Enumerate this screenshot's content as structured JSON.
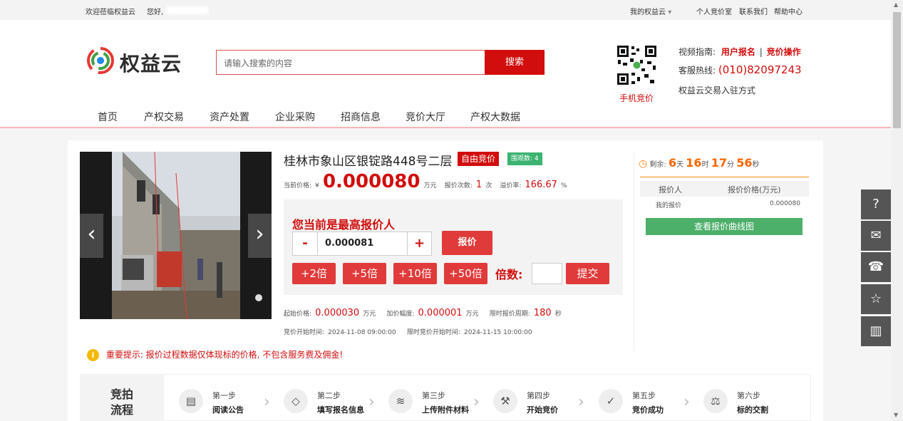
{
  "topbar": {
    "welcome": "欢迎莅临权益云",
    "hello": "您好,",
    "my_account": "我的权益云",
    "personal_bid": "个人竞价室",
    "contact": "联系我们",
    "help": "帮助中心"
  },
  "header": {
    "logo_text": "权益云",
    "search_placeholder": "请输入搜索的内容",
    "search_button": "搜索",
    "qr_label": "手机竞价",
    "video_guide_label": "视频指南:",
    "user_signup": "用户报名",
    "separator": "|",
    "bid_operation": "竞价操作",
    "hotline_label": "客服热线:",
    "hotline": "(010)82097243",
    "join": "权益云交易入驻方式"
  },
  "nav": [
    "首页",
    "产权交易",
    "资产处置",
    "企业采购",
    "招商信息",
    "竞价大厅",
    "产权大数据"
  ],
  "listing": {
    "title": "桂林市象山区银锭路448号二层",
    "tag_free": "自由竞价",
    "viewers_label": "围观数:",
    "viewers": "4",
    "current_price_label": "当前价格:",
    "currency": "¥",
    "current_price": "0.000080",
    "price_unit": "万元",
    "bid_count_label": "报价次数:",
    "bid_count": "1",
    "bid_count_unit": "次",
    "premium_label": "溢价率:",
    "premium": "166.67",
    "premium_unit": "%",
    "start_price_label": "起始价格:",
    "start_price": "0.000030",
    "increment_label": "加价幅度:",
    "increment": "0.000001",
    "limit_period_label": "限时报价周期:",
    "limit_period": "180",
    "limit_period_unit": "秒",
    "bid_start_label": "竞价开始时间:",
    "bid_start": "2024-11-08 09:00:00",
    "limit_start_label": "限时竞价开始时间:",
    "limit_start": "2024-11-15 10:00:00"
  },
  "bid": {
    "highest_msg": "您当前是最高报价人",
    "minus": "-",
    "value": "0.000081",
    "plus": "+",
    "submit_bid": "报价",
    "mult2": "+2倍",
    "mult5": "+5倍",
    "mult10": "+10倍",
    "mult50": "+50倍",
    "multiple_label": "倍数:",
    "multiple_value": "",
    "submit": "提交"
  },
  "countdown": {
    "label": "剩余:",
    "days": "6",
    "days_unit": "天",
    "hours": "16",
    "hours_unit": "时",
    "minutes": "17",
    "minutes_unit": "分",
    "seconds": "56",
    "seconds_unit": "秒"
  },
  "bid_table": {
    "col1": "报价人",
    "col2": "报价价格(万元)",
    "row_bidder": "我的报价",
    "row_price": "0.000080",
    "curve_button": "查看报价曲线图"
  },
  "notice": "重要提示: 报价过程数据仅体现标的价格, 不包含服务费及佣金!",
  "flow": {
    "title_line1": "竞拍",
    "title_line2": "流程",
    "steps": [
      {
        "num": "第一步",
        "text": "阅读公告",
        "icon": "document-icon"
      },
      {
        "num": "第二步",
        "text": "填写报名信息",
        "icon": "tag-icon"
      },
      {
        "num": "第三步",
        "text": "上传附件材料",
        "icon": "coins-icon"
      },
      {
        "num": "第四步",
        "text": "开始竞价",
        "icon": "gavel-icon"
      },
      {
        "num": "第五步",
        "text": "竞价成功",
        "icon": "check-icon"
      },
      {
        "num": "第六步",
        "text": "标的交割",
        "icon": "scale-icon"
      }
    ]
  },
  "colors": {
    "brand_red": "#d10d0d",
    "green": "#4caf6a",
    "orange": "#ff6600"
  }
}
